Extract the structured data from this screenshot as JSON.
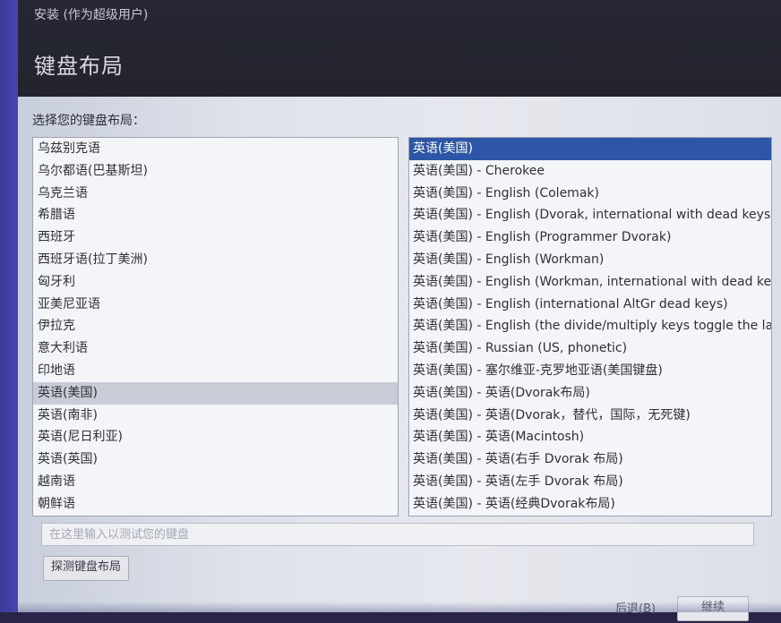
{
  "window": {
    "title": "安装 (作为超级用户)"
  },
  "page": {
    "title": "键盘布局",
    "prompt": "选择您的键盘布局："
  },
  "languages": [
    "乌兹别克语",
    "乌尔都语(巴基斯坦)",
    "乌克兰语",
    "希腊语",
    "西班牙",
    "西班牙语(拉丁美洲)",
    "匈牙利",
    "亚美尼亚语",
    "伊拉克",
    "意大利语",
    "印地语",
    "英语(美国)",
    "英语(南非)",
    "英语(尼日利亚)",
    "英语(英国)",
    "越南语",
    "朝鲜语"
  ],
  "selected_language": "英语(美国)",
  "variants": [
    "英语(美国)",
    "英语(美国) - Cherokee",
    "英语(美国) - English (Colemak)",
    "英语(美国) - English (Dvorak, international with dead keys)",
    "英语(美国) - English (Programmer Dvorak)",
    "英语(美国) - English (Workman)",
    "英语(美国) - English (Workman, international with dead keys)",
    "英语(美国) - English (international AltGr dead keys)",
    "英语(美国) - English (the divide/multiply keys toggle the layout)",
    "英语(美国) - Russian (US, phonetic)",
    "英语(美国) - 塞尔维亚-克罗地亚语(美国键盘)",
    "英语(美国) - 英语(Dvorak布局)",
    "英语(美国) - 英语(Dvorak，替代，国际，无死键)",
    "英语(美国) - 英语(Macintosh)",
    "英语(美国) - 英语(右手 Dvorak 布局)",
    "英语(美国) - 英语(左手 Dvorak 布局)",
    "英语(美国) - 英语(经典Dvorak布局)"
  ],
  "selected_variant": "英语(美国)",
  "test_input": {
    "placeholder": "在这里输入以测试您的键盘",
    "value": ""
  },
  "buttons": {
    "detect": "探测键盘布局",
    "back": "后退(B)",
    "next": "继续"
  }
}
